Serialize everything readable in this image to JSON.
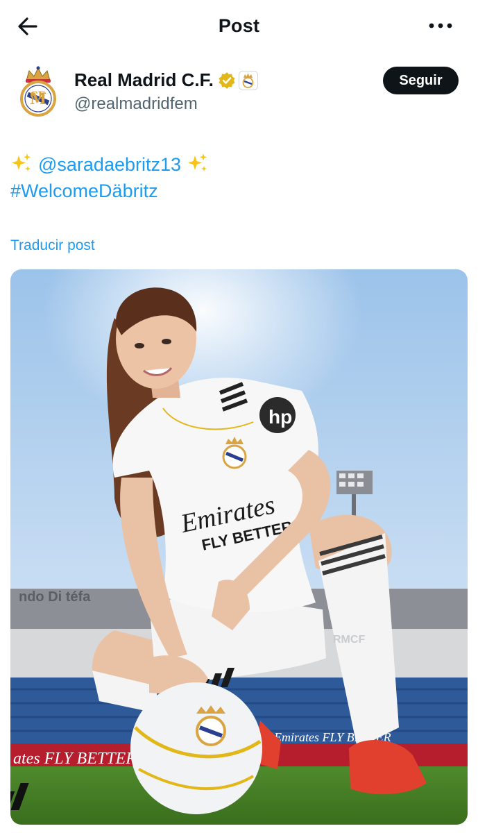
{
  "header": {
    "title": "Post",
    "back_icon": "arrow-left-icon",
    "more_icon": "more-horizontal-icon"
  },
  "author": {
    "name": "Real Madrid C.F.",
    "handle": "@realmadridfem",
    "verified_icon": "verified-gold-icon",
    "affiliate_badge_icon": "real-madrid-crest-icon",
    "follow_label": "Seguir"
  },
  "tweet": {
    "mention": "@saradaebritz13",
    "hashtag": "#WelcomeDäbritz",
    "translate_label": "Traducir post",
    "media": {
      "shirt_sponsor_line1": "Emirates",
      "shirt_sponsor_line2": "FLY BETTER",
      "sock_text": "RMCF",
      "board_text_left": "ates FLY BETTER",
      "board_text_right": "Emirates FLY BETTER",
      "stand_text": "ndo Di   téfa"
    }
  },
  "colors": {
    "link": "#1d9bf0",
    "text": "#0f1419",
    "secondary_text": "#536471",
    "verified_gold": "#e2b719",
    "follow_bg": "#0f1419"
  }
}
